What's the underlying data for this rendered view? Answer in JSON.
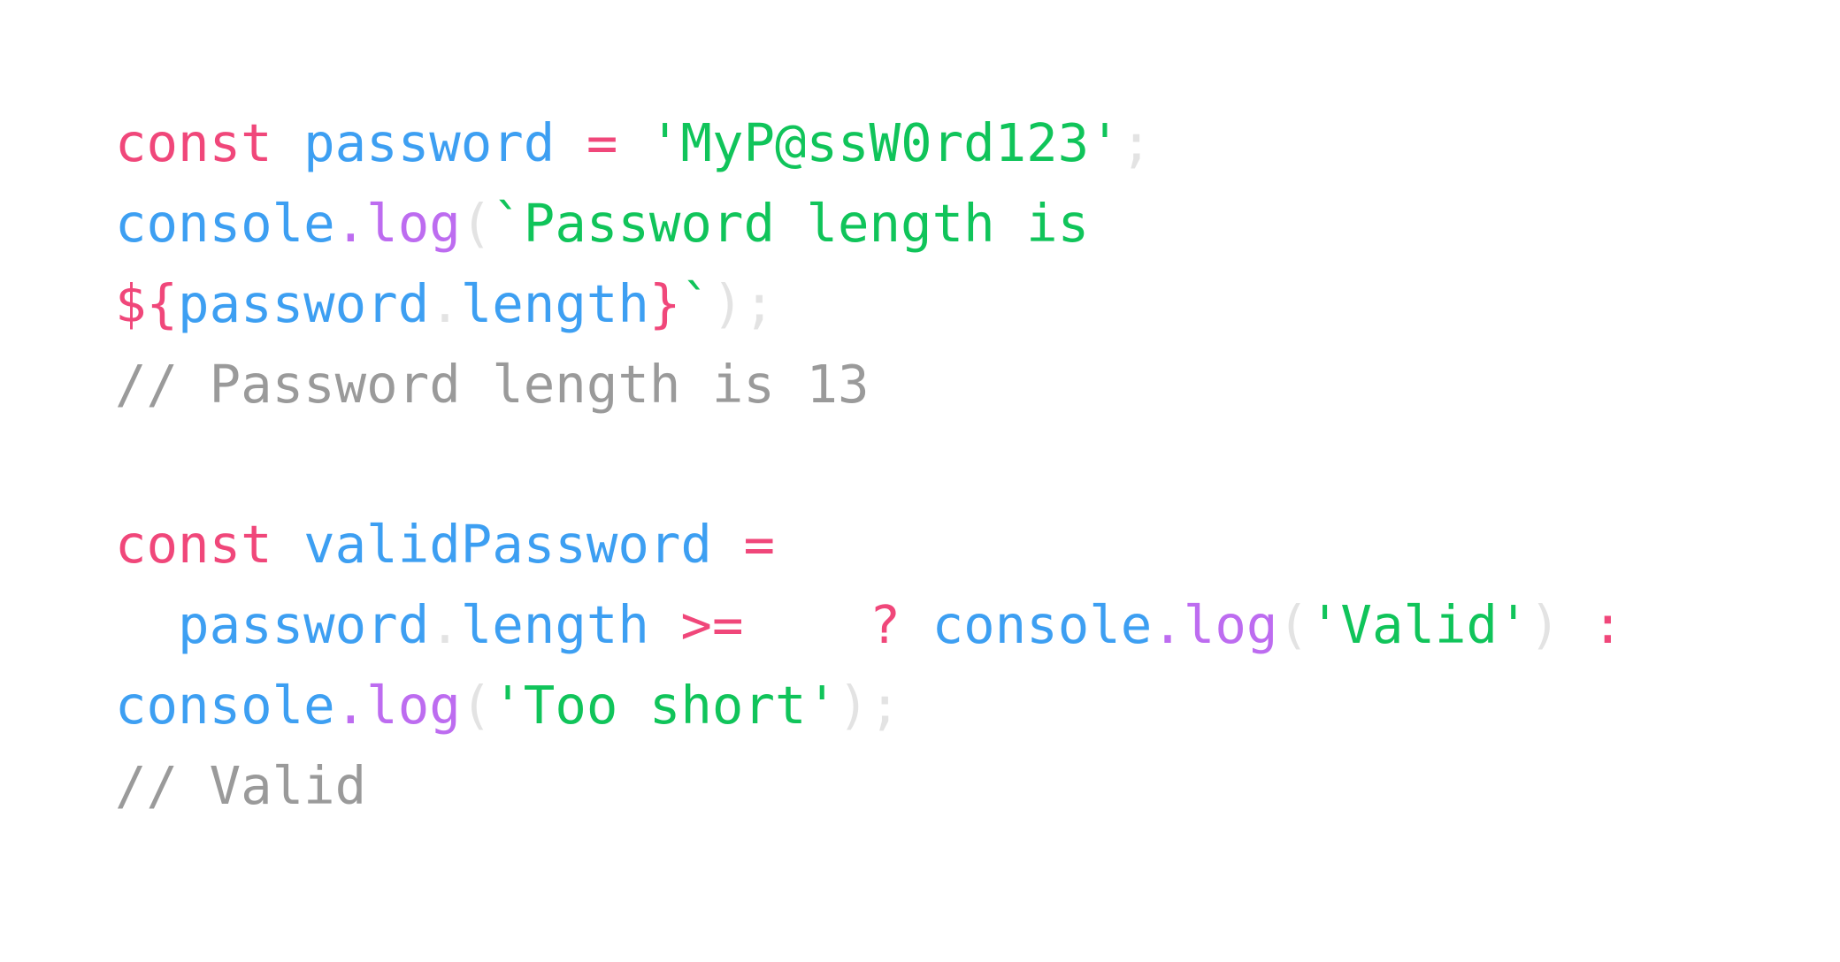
{
  "colors": {
    "keyword": "#f0477a",
    "identifier": "#3d9ff2",
    "string": "#10c45a",
    "method": "#bd6cf0",
    "punctuation": "#e3e3e3",
    "comment": "#9a9a9a",
    "background": "#ffffff"
  },
  "code": {
    "lines": [
      {
        "tokens": [
          {
            "text": "const",
            "kind": "keyword"
          },
          {
            "text": " ",
            "kind": "plain"
          },
          {
            "text": "password",
            "kind": "identifier"
          },
          {
            "text": " ",
            "kind": "plain"
          },
          {
            "text": "=",
            "kind": "keyword"
          },
          {
            "text": " ",
            "kind": "plain"
          },
          {
            "text": "'MyP@ssW0rd123'",
            "kind": "string"
          },
          {
            "text": ";",
            "kind": "punctuation"
          }
        ]
      },
      {
        "tokens": [
          {
            "text": "console",
            "kind": "identifier"
          },
          {
            "text": ".log",
            "kind": "method"
          },
          {
            "text": "(",
            "kind": "punctuation"
          },
          {
            "text": "`Password length is",
            "kind": "string"
          }
        ]
      },
      {
        "tokens": [
          {
            "text": "${",
            "kind": "keyword"
          },
          {
            "text": "password",
            "kind": "identifier"
          },
          {
            "text": ".",
            "kind": "punctuation"
          },
          {
            "text": "length",
            "kind": "identifier"
          },
          {
            "text": "}",
            "kind": "keyword"
          },
          {
            "text": "`",
            "kind": "string"
          },
          {
            "text": ");",
            "kind": "punctuation"
          }
        ]
      },
      {
        "tokens": [
          {
            "text": "// Password length is 13",
            "kind": "comment"
          }
        ]
      },
      {
        "blank": true,
        "tokens": []
      },
      {
        "tokens": [
          {
            "text": "const",
            "kind": "keyword"
          },
          {
            "text": " ",
            "kind": "plain"
          },
          {
            "text": "validPassword",
            "kind": "identifier"
          },
          {
            "text": " ",
            "kind": "plain"
          },
          {
            "text": "=",
            "kind": "keyword"
          }
        ]
      },
      {
        "tokens": [
          {
            "text": "  ",
            "kind": "plain"
          },
          {
            "text": "password",
            "kind": "identifier"
          },
          {
            "text": ".",
            "kind": "punctuation"
          },
          {
            "text": "length",
            "kind": "identifier"
          },
          {
            "text": " ",
            "kind": "plain"
          },
          {
            "text": ">=",
            "kind": "keyword"
          },
          {
            "text": "    ",
            "kind": "plain"
          },
          {
            "text": "?",
            "kind": "keyword"
          },
          {
            "text": " ",
            "kind": "plain"
          },
          {
            "text": "console",
            "kind": "identifier"
          },
          {
            "text": ".log",
            "kind": "method"
          },
          {
            "text": "(",
            "kind": "punctuation"
          },
          {
            "text": "'Valid'",
            "kind": "string"
          },
          {
            "text": ")",
            "kind": "punctuation"
          },
          {
            "text": " ",
            "kind": "plain"
          },
          {
            "text": ":",
            "kind": "keyword"
          }
        ]
      },
      {
        "tokens": [
          {
            "text": "console",
            "kind": "identifier"
          },
          {
            "text": ".log",
            "kind": "method"
          },
          {
            "text": "(",
            "kind": "punctuation"
          },
          {
            "text": "'Too short'",
            "kind": "string"
          },
          {
            "text": ");",
            "kind": "punctuation"
          }
        ]
      },
      {
        "tokens": [
          {
            "text": "// Valid",
            "kind": "comment"
          }
        ]
      }
    ]
  }
}
